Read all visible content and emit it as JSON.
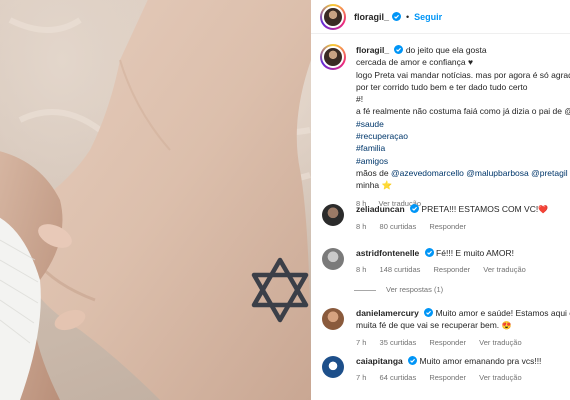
{
  "post": {
    "username": "floragil_",
    "follow_label": "Seguir",
    "separator": "•"
  },
  "caption": {
    "username": "floragil_",
    "line1": "do jeito que ela gosta",
    "line2": "cercada de amor e confiança ♥",
    "line3": "logo Preta vai mandar notícias. mas por agora é só agrade",
    "line4": "por ter corrido tudo bem e ter dado tudo certo",
    "line5": "#!",
    "line6": "a fé realmente não costuma faiá como já dizia o pai de @p",
    "hashtags": [
      "#saude",
      "#recuperaçao",
      "#familia",
      "#amigos"
    ],
    "mentions_prefix": "mãos de",
    "mentions": [
      "@azevedomarcello",
      "@malupbarbosa",
      "@pretagil"
    ],
    "mentions_suffix": "e",
    "end_text": "minha",
    "end_emoji": "⭐",
    "time": "8 h",
    "translate": "Ver tradução"
  },
  "comments": [
    {
      "username": "zeliaduncan",
      "text": "PRETA!!! ESTAMOS COM VC!",
      "emoji": "❤️",
      "time": "8 h",
      "likes": "80 curtidas",
      "reply": "Responder",
      "avatar_color": "#2b2b2b"
    },
    {
      "username": "astridfontenelle",
      "text": "Fé!!! E muito AMOR!",
      "emoji": "",
      "time": "8 h",
      "likes": "148 curtidas",
      "reply": "Responder",
      "translate": "Ver tradução",
      "avatar_color": "#7a7a7a"
    },
    {
      "username": "danielamercury",
      "line1": "Muito amor e saúde! Estamos aqui com",
      "line2": "muita fé de que vai se recuperar bem.",
      "emoji": "😍",
      "time": "7 h",
      "likes": "35 curtidas",
      "reply": "Responder",
      "translate": "Ver tradução",
      "avatar_color": "#8a5a3c"
    },
    {
      "username": "caiapitanga",
      "text": "Muito amor emanando pra vcs!!!",
      "time": "7 h",
      "likes": "64 curtidas",
      "reply": "Responder",
      "translate": "Ver tradução",
      "avatar_color": "#1d4f8a"
    }
  ],
  "replies_label": "Ver respostas (1)",
  "colors": {
    "link": "#00376b",
    "follow": "#0095f6",
    "verified": "#0095f6",
    "muted": "#737373"
  }
}
